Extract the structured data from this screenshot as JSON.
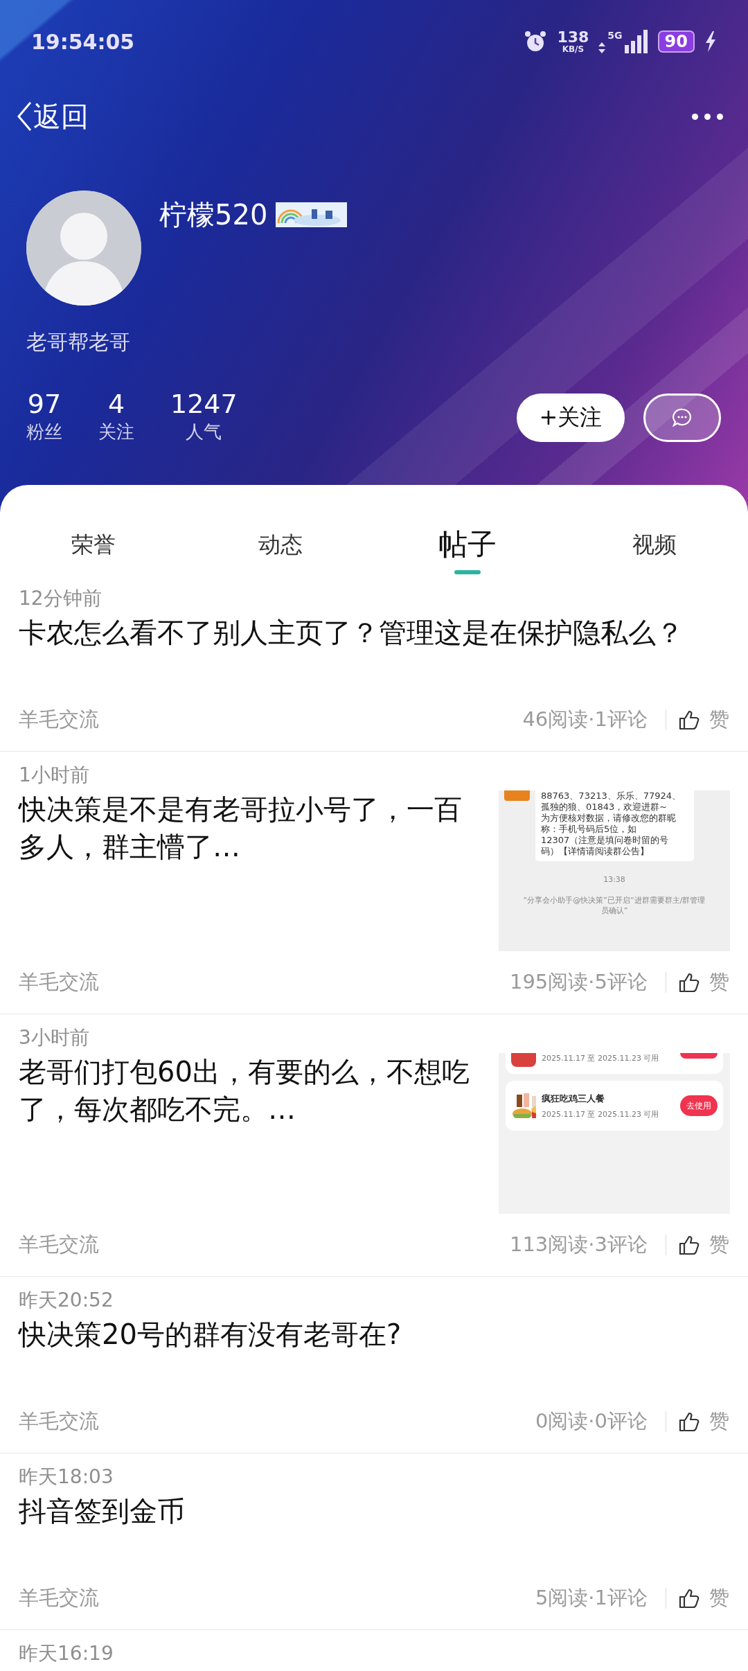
{
  "status_bar": {
    "time": "19:54:05",
    "speed": "138",
    "speed_unit": "KB/S",
    "network": "5G",
    "battery": "90"
  },
  "nav": {
    "back": "返回"
  },
  "profile": {
    "name": "柠檬520",
    "bio": "老哥帮老哥",
    "follow_button": "+关注",
    "stats": [
      {
        "value": "97",
        "label": "粉丝"
      },
      {
        "value": "4",
        "label": "关注"
      },
      {
        "value": "1247",
        "label": "人气"
      }
    ]
  },
  "tabs": [
    {
      "label": "荣誉",
      "selected": false
    },
    {
      "label": "动态",
      "selected": false
    },
    {
      "label": "帖子",
      "selected": true
    },
    {
      "label": "视频",
      "selected": false
    }
  ],
  "posts": [
    {
      "time": "12分钟前",
      "title": "卡农怎么看不了别人主页了？管理这是在保护隐私么？",
      "category": "羊毛交流",
      "stats": "46阅读·1评论",
      "like": "赞"
    },
    {
      "time": "1小时前",
      "title": "快决策是不是有老哥拉小号了，一百多人，群主懵了…",
      "category": "羊毛交流",
      "stats": "195阅读·5评论",
      "like": "赞",
      "thumbnail": {
        "kind": "chat",
        "bubble_lines": [
          "88763、73213、乐乐、77924、",
          "孤独的狼、01843，欢迎进群~",
          "为方便核对数据，请修改您的群昵",
          "称：手机号码后5位，如",
          "12307（注意是填问卷时留的号",
          "码）【详情请阅读群公告】"
        ],
        "timestamp": "13:38",
        "notice_lines": [
          "“分享会小助手@快决策”已开启“进群需要群主/群管理",
          "员确认”"
        ]
      }
    },
    {
      "time": "3小时前",
      "title": "老哥们打包60出，有要的么，不想吃了，每次都吃不完。…",
      "category": "羊毛交流",
      "stats": "113阅读·3评论",
      "like": "赞",
      "thumbnail": {
        "kind": "coupons",
        "cards": [
          {
            "partial": true,
            "date": "2025.11.17 至 2025.11.23 可用"
          },
          {
            "partial": false,
            "title": "疯狂吃鸡三人餐",
            "date": "2025.11.17 至 2025.11.23 可用",
            "button": "去使用"
          }
        ]
      }
    },
    {
      "time": "昨天20:52",
      "title": "快决策20号的群有没有老哥在?",
      "category": "羊毛交流",
      "stats": "0阅读·0评论",
      "like": "赞"
    },
    {
      "time": "昨天18:03",
      "title": "抖音签到金币",
      "category": "羊毛交流",
      "stats": "5阅读·1评论",
      "like": "赞"
    },
    {
      "time": "昨天16:19"
    }
  ]
}
